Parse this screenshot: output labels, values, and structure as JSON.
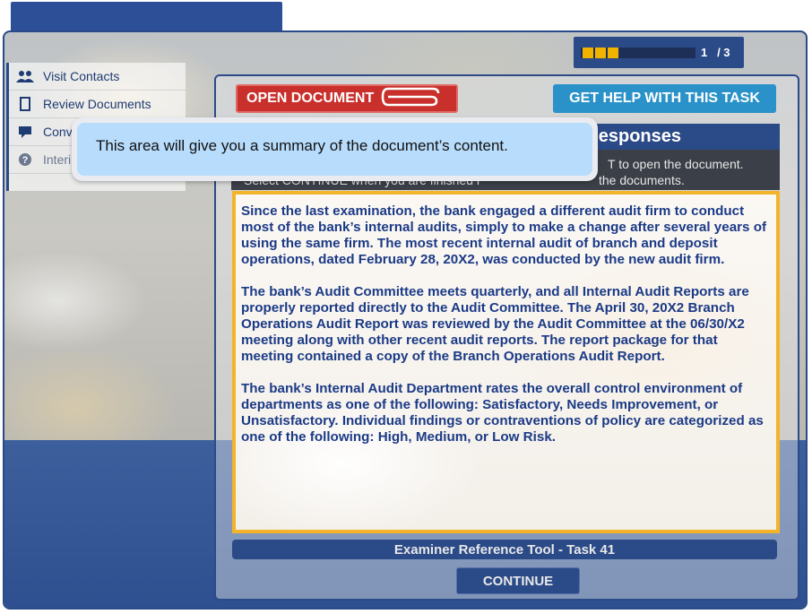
{
  "progress": {
    "current": 1,
    "total": 3,
    "label": "1   / 3",
    "filled_fraction": 0.33
  },
  "sidebar": {
    "items": [
      {
        "label": "Visit Contacts",
        "icon": "people-icon"
      },
      {
        "label": "Review Documents",
        "icon": "document-icon"
      },
      {
        "label": "Conv",
        "icon": "chat-icon"
      },
      {
        "label": "Interi",
        "icon": "help-icon"
      }
    ]
  },
  "toolbar": {
    "open_document": "OPEN DOCUMENT",
    "get_help": "GET HELP WITH THIS TASK"
  },
  "responses": {
    "header": "esponses",
    "instr_left_1": "",
    "instr_left_2": "Select CONTINUE when you are finished r",
    "instr_right_1": "T to open the document.",
    "instr_right_2": "the documents."
  },
  "tooltip": {
    "text": "This area will give you a summary of the document’s content."
  },
  "summary": {
    "paragraphs": [
      "Since the last examination, the bank engaged a different audit firm to conduct most of the bank’s internal audits, simply to make a change after several years of using the same firm. The most recent internal audit of branch and deposit operations, dated February 28, 20X2, was conducted by the new audit firm.",
      "The bank’s Audit Committee meets quarterly, and all Internal Audit Reports are properly reported directly to the Audit Committee. The April 30, 20X2 Branch Operations Audit Report was reviewed by the Audit Committee at the 06/30/X2 meeting along with other recent audit reports. The report package for that meeting contained a copy of the Branch Operations Audit Report.",
      "The bank’s Internal Audit Department rates the overall control environment of departments as one of the following: Satisfactory, Needs Improvement, or Unsatisfactory. Individual findings or contraventions of policy are categorized as one of the following: High, Medium, or Low Risk."
    ]
  },
  "footer": {
    "tool_title": "Examiner Reference Tool - Task 41",
    "continue_label": "CONTINUE"
  },
  "colors": {
    "navy": "#2b4a88",
    "gold": "#f4b42a",
    "red": "#c9302c",
    "help_blue": "#2a92c8",
    "tooltip_blue": "#b8dcfb"
  }
}
